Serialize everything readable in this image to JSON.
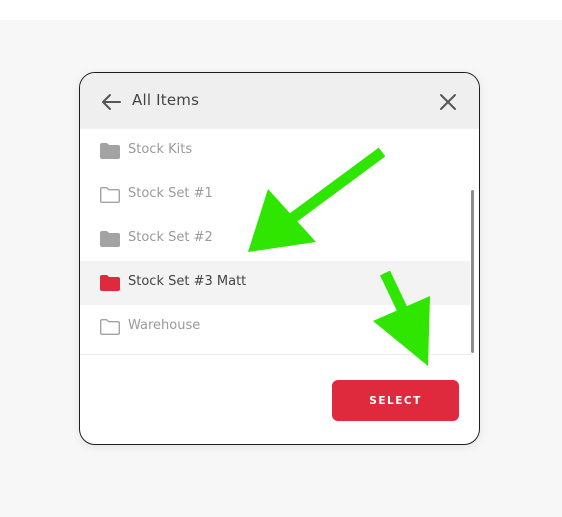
{
  "dialog": {
    "title": "All Items",
    "items": [
      {
        "label": "Stock Kits",
        "icon": "folder-filled-icon",
        "selected": false
      },
      {
        "label": "Stock Set #1",
        "icon": "folder-outline-icon",
        "selected": false
      },
      {
        "label": "Stock Set #2",
        "icon": "folder-filled-icon",
        "selected": false
      },
      {
        "label": "Stock Set #3 Matt",
        "icon": "folder-filled-icon",
        "selected": true
      },
      {
        "label": "Warehouse",
        "icon": "folder-outline-icon",
        "selected": false
      }
    ],
    "select_label": "SELECT"
  },
  "colors": {
    "accent": "#de2a3c",
    "folder_gray": "#a3a3a3",
    "folder_selected": "#de2a3c",
    "annotation_arrow": "#2ee600",
    "header_bg": "#eeefee"
  },
  "annotations": {
    "arrows": [
      "annotation-arrow-icon",
      "annotation-arrow-icon"
    ]
  }
}
